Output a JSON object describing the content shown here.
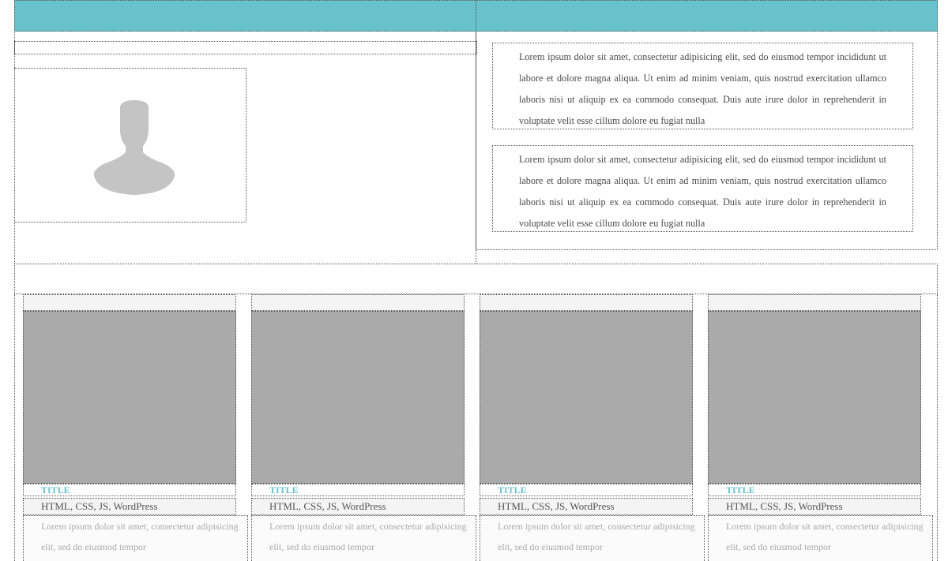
{
  "profile": {
    "paragraphs": [
      "Lorem ipsum dolor sit amet, consectetur adipisicing elit, sed do eiusmod tempor incididunt ut labore et dolore magna aliqua. Ut enim ad minim veniam, quis nostrud exercitation ullamco laboris nisi ut aliquip ex ea commodo consequat. Duis aute irure dolor in reprehenderit in voluptate velit esse cillum dolore eu fugiat nulla",
      "Lorem ipsum dolor sit amet, consectetur adipisicing elit, sed do eiusmod tempor incididunt ut labore et dolore magna aliqua. Ut enim ad minim veniam, quis nostrud exercitation ullamco laboris nisi ut aliquip ex ea commodo consequat. Duis aute irure dolor in reprehenderit in voluptate velit esse cillum dolore eu fugiat nulla"
    ]
  },
  "colors": {
    "accent": "#67c2cc",
    "placeholder": "#aaaaaa"
  },
  "projects": [
    {
      "title": "TITLE",
      "tags": "HTML, CSS, JS, WordPress",
      "description": "Lorem ipsum dolor sit amet, consectetur adipisicing elit, sed do eiusmod tempor"
    },
    {
      "title": "TITLE",
      "tags": "HTML, CSS, JS, WordPress",
      "description": "Lorem ipsum dolor sit amet, consectetur adipisicing elit, sed do eiusmod tempor"
    },
    {
      "title": "TITLE",
      "tags": "HTML, CSS, JS, WordPress",
      "description": "Lorem ipsum dolor sit amet, consectetur adipisicing elit, sed do eiusmod tempor"
    },
    {
      "title": "TITLE",
      "tags": "HTML, CSS, JS, WordPress",
      "description": "Lorem ipsum dolor sit amet, consectetur adipisicing elit, sed do eiusmod tempor"
    }
  ]
}
